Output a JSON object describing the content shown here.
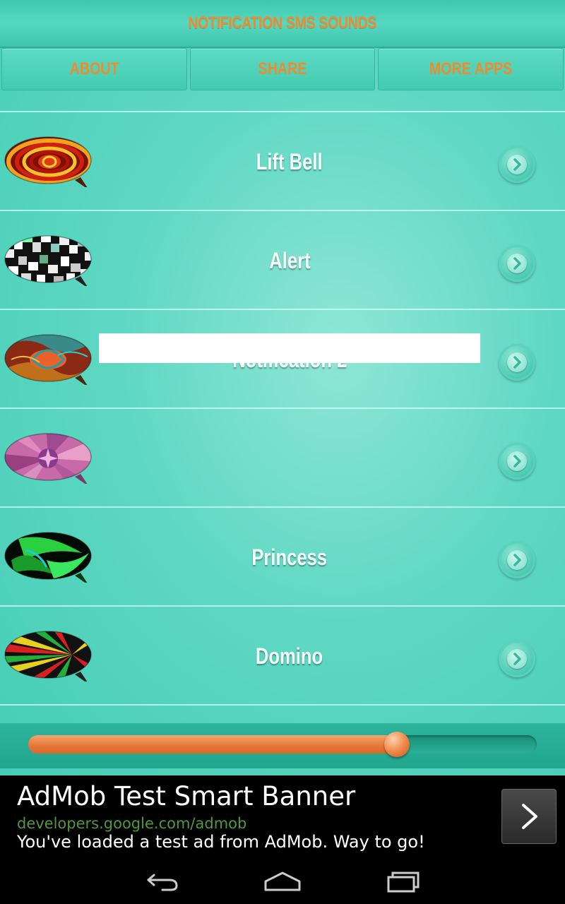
{
  "header": {
    "title": "NOTIFICATION SMS SOUNDS"
  },
  "top_buttons": [
    {
      "label": "ABOUT"
    },
    {
      "label": "SHARE"
    },
    {
      "label": "MORE APPS"
    }
  ],
  "sounds": [
    {
      "label": "Lift Bell",
      "icon": "swirl-bubble-icon"
    },
    {
      "label": "Alert",
      "icon": "checkered-bubble-icon"
    },
    {
      "label": "Notification 2",
      "icon": "psychedelic-bubble-icon"
    },
    {
      "label": "",
      "icon": "kaleidoscope-bubble-icon"
    },
    {
      "label": "Princess",
      "icon": "green-abstract-bubble-icon"
    },
    {
      "label": "Domino",
      "icon": "rainbow-ray-bubble-icon"
    }
  ],
  "player": {
    "progress": 0.725
  },
  "ad": {
    "title": "AdMob Test Smart Banner",
    "url": "developers.google.com/admob",
    "description": "You've loaded a test ad from AdMob. Way to go!"
  },
  "colors": {
    "accent": "#f08a2c",
    "background": "#5fd8c3",
    "progress": "#e67a3a"
  }
}
